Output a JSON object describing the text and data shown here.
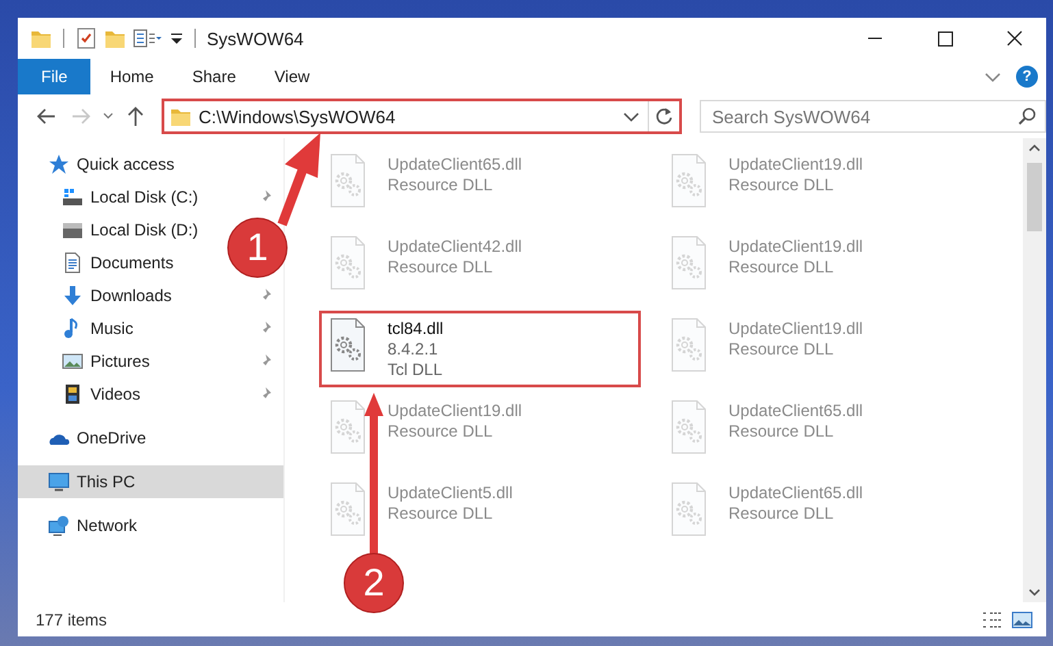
{
  "window": {
    "title": "SysWOW64"
  },
  "ribbon": {
    "tabs": [
      {
        "label": "File",
        "kind": "file"
      },
      {
        "label": "Home",
        "kind": "tab"
      },
      {
        "label": "Share",
        "kind": "tab"
      },
      {
        "label": "View",
        "kind": "tab"
      }
    ],
    "help": "?"
  },
  "navigation": {
    "back_disabled": false,
    "forward_disabled": true
  },
  "address_bar": {
    "path": "C:\\Windows\\SysWOW64",
    "highlighted": true
  },
  "search": {
    "placeholder": "Search SysWOW64"
  },
  "sidebar": {
    "items": [
      {
        "label": "Quick access",
        "kind": "quick",
        "selected": false,
        "children": [
          {
            "label": "Local Disk (C:)",
            "kind": "diskc",
            "pinned": true
          },
          {
            "label": "Local Disk (D:)",
            "kind": "disk",
            "pinned": false
          },
          {
            "label": "Documents",
            "kind": "docs",
            "pinned": false
          },
          {
            "label": "Downloads",
            "kind": "downloads",
            "pinned": true
          },
          {
            "label": "Music",
            "kind": "music",
            "pinned": true
          },
          {
            "label": "Pictures",
            "kind": "pictures",
            "pinned": true
          },
          {
            "label": "Videos",
            "kind": "videos",
            "pinned": true
          }
        ]
      },
      {
        "label": "OneDrive",
        "kind": "cloud",
        "selected": false
      },
      {
        "label": "This PC",
        "kind": "pc",
        "selected": true
      },
      {
        "label": "Network",
        "kind": "network",
        "selected": false
      }
    ]
  },
  "files": [
    {
      "name": "UpdateClient65.dll",
      "type": "Resource DLL",
      "faded": true,
      "highlighted": false
    },
    {
      "name": "UpdateClient19.dll",
      "type": "Resource DLL",
      "faded": true,
      "highlighted": false
    },
    {
      "name": "UpdateClient42.dll",
      "type": "Resource DLL",
      "faded": true,
      "highlighted": false
    },
    {
      "name": "UpdateClient19.dll",
      "type": "Resource DLL",
      "faded": true,
      "highlighted": false
    },
    {
      "name": "tcl84.dll",
      "version": "8.4.2.1",
      "type": "Tcl DLL",
      "faded": false,
      "highlighted": true
    },
    {
      "name": "UpdateClient19.dll",
      "type": "Resource DLL",
      "faded": true,
      "highlighted": false
    },
    {
      "name": "UpdateClient19.dll",
      "type": "Resource DLL",
      "faded": true,
      "highlighted": false
    },
    {
      "name": "UpdateClient65.dll",
      "type": "Resource DLL",
      "faded": true,
      "highlighted": false
    },
    {
      "name": "UpdateClient5.dll",
      "type": "Resource DLL",
      "faded": true,
      "highlighted": false
    },
    {
      "name": "UpdateClient65.dll",
      "type": "Resource DLL",
      "faded": true,
      "highlighted": false
    }
  ],
  "status_bar": {
    "count": "177 items"
  },
  "annotations": [
    {
      "label": "1"
    },
    {
      "label": "2"
    }
  ]
}
